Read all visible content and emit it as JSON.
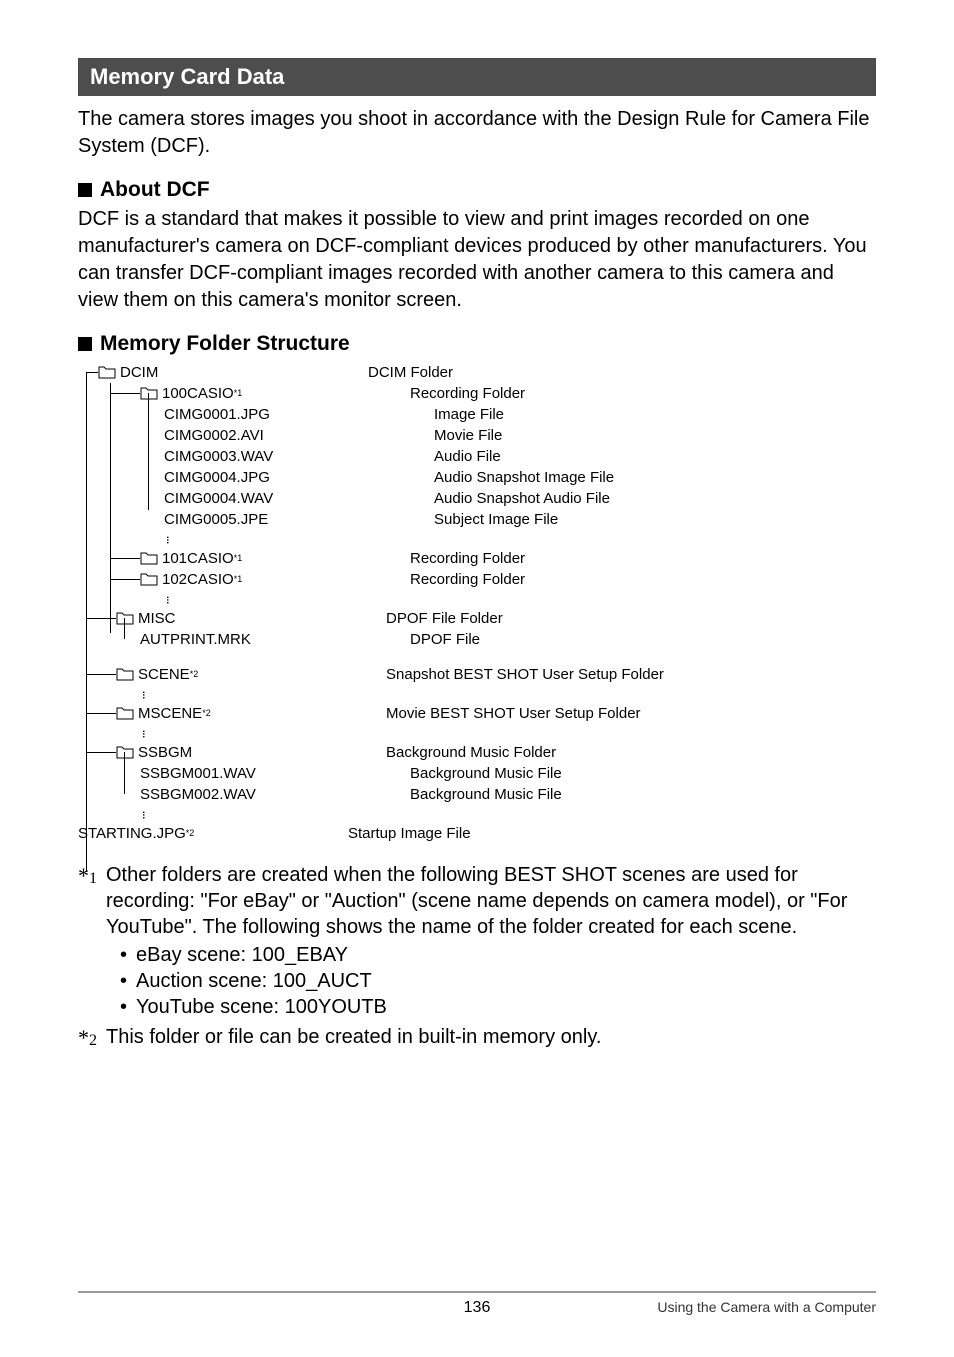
{
  "section_title": "Memory Card Data",
  "intro": "The camera stores images you shoot in accordance with the Design Rule for Camera File System (DCF).",
  "sub1_title": "About DCF",
  "sub1_body": "DCF is a standard that makes it possible to view and print images recorded on one manufacturer's camera on DCF-compliant devices produced by other manufacturers. You can transfer DCF-compliant images recorded with another camera to this camera and view them on this camera's monitor screen.",
  "sub2_title": "Memory Folder Structure",
  "tree": {
    "dcim": {
      "name": "DCIM",
      "desc": "DCIM Folder"
    },
    "f100": {
      "name": "100CASIO",
      "sup": "*1",
      "desc": "Recording Folder"
    },
    "c1": {
      "name": "CIMG0001.JPG",
      "desc": "Image File"
    },
    "c2": {
      "name": "CIMG0002.AVI",
      "desc": "Movie File"
    },
    "c3": {
      "name": "CIMG0003.WAV",
      "desc": "Audio File"
    },
    "c4": {
      "name": "CIMG0004.JPG",
      "desc": "Audio Snapshot Image File"
    },
    "c5": {
      "name": "CIMG0004.WAV",
      "desc": "Audio Snapshot Audio File"
    },
    "c6": {
      "name": "CIMG0005.JPE",
      "desc": "Subject Image File"
    },
    "f101": {
      "name": "101CASIO",
      "sup": "*1",
      "desc": "Recording Folder"
    },
    "f102": {
      "name": "102CASIO",
      "sup": "*1",
      "desc": "Recording Folder"
    },
    "misc": {
      "name": "MISC",
      "desc": "DPOF File Folder"
    },
    "autp": {
      "name": "AUTPRINT.MRK",
      "desc": "DPOF File"
    },
    "scene": {
      "name": "SCENE",
      "sup": "*2",
      "desc": "Snapshot BEST SHOT User Setup Folder"
    },
    "mscene": {
      "name": "MSCENE",
      "sup": "*2",
      "desc": "Movie BEST SHOT User Setup Folder"
    },
    "ssbgm": {
      "name": "SSBGM",
      "desc": "Background Music Folder"
    },
    "ss1": {
      "name": "SSBGM001.WAV",
      "desc": "Background Music File"
    },
    "ss2": {
      "name": "SSBGM002.WAV",
      "desc": "Background Music File"
    },
    "start": {
      "name": "STARTING.JPG",
      "sup": "*2",
      "desc": "Startup Image File"
    }
  },
  "fn1_mark": "*1",
  "fn1_body": "Other folders are created when the following BEST SHOT scenes are used for recording: \"For eBay\" or \"Auction\" (scene name depends on camera model), or \"For YouTube\". The following shows the name of the folder created for each scene.",
  "fn1_bullets": [
    "eBay scene: 100_EBAY",
    "Auction scene: 100_AUCT",
    "YouTube scene: 100YOUTB"
  ],
  "fn2_mark": "*2",
  "fn2_body": "This folder or file can be created in built-in memory only.",
  "page_number": "136",
  "footer_right": "Using the Camera with a Computer"
}
